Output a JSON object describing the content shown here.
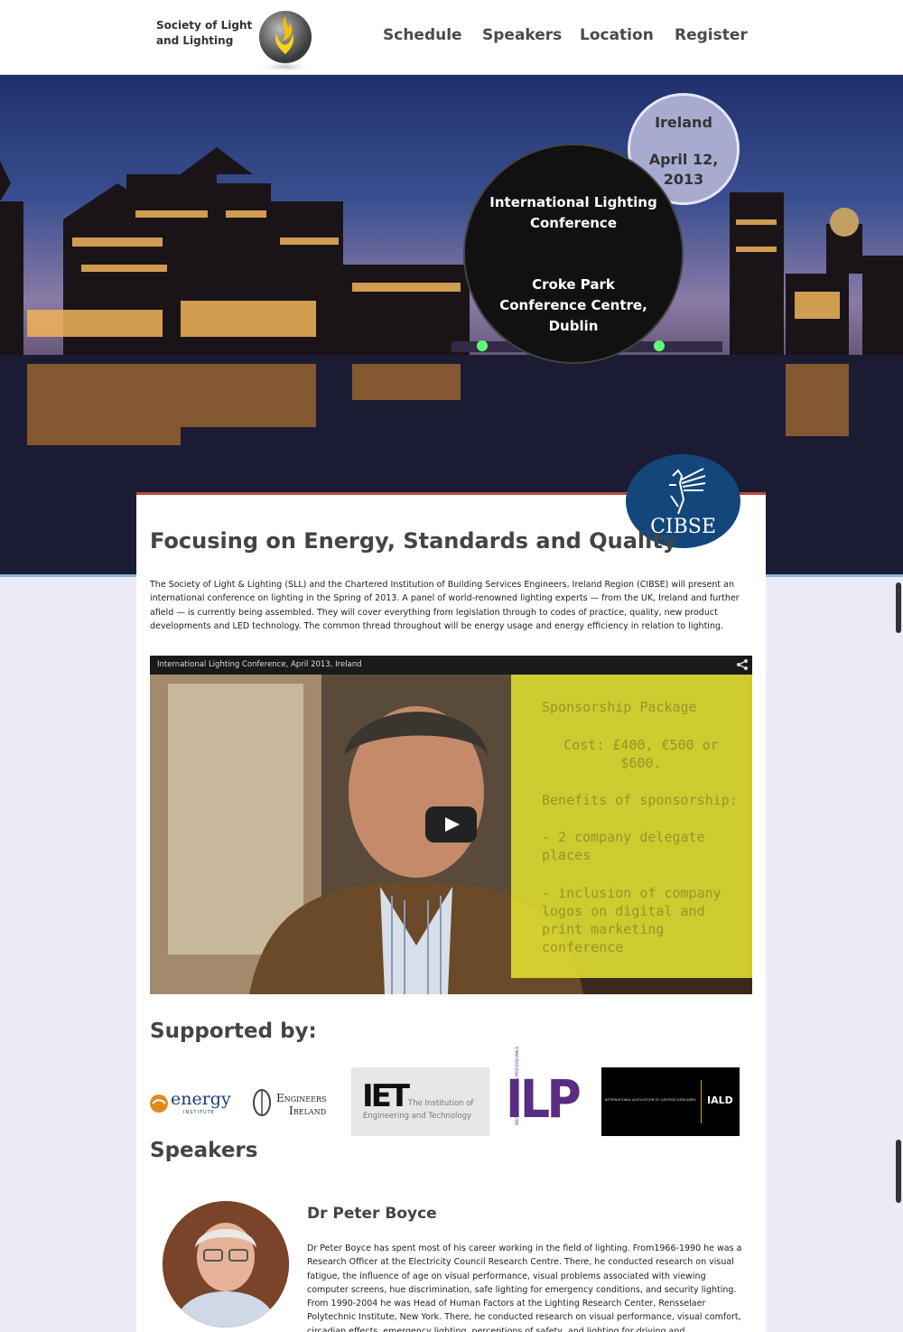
{
  "header": {
    "brand_line1": "Society of Light",
    "brand_line2": "and Lighting",
    "nav": [
      "Schedule",
      "Speakers",
      "Location",
      "Register"
    ]
  },
  "hero": {
    "country": "Ireland",
    "date": "April 12, 2013",
    "conference_title": "International Lighting Conference",
    "venue": "Croke Park Conference Centre, Dublin",
    "badge": "CIBSE"
  },
  "main": {
    "heading": "Focusing on Energy, Standards and Quality",
    "intro": "The Society of Light & Lighting (SLL) and the Chartered Institution of Building Services Engineers, Ireland Region (CIBSE) will present an international conference on lighting in the Spring of 2013. A panel of world-renowned lighting experts — from the UK, Ireland and further afield — is currently being assembled. They will cover everything from legislation through to codes of practice, quality, new product developments and LED technology. The common thread throughout will be energy usage and energy efficiency in relation to lighting."
  },
  "video": {
    "title": "International Lighting Conference, April 2013, Ireland",
    "sponsor_heading": "Sponsorship Package",
    "sponsor_cost": "Cost: £400, €500 or $600.",
    "sponsor_benefits": "Benefits of sponsorship:",
    "sponsor_item1": "- 2 company delegate places",
    "sponsor_item2": "- inclusion of company logos on digital and print marketing conference"
  },
  "supported": {
    "heading": "Supported by:",
    "logos": {
      "energy": "energy",
      "energy_sub": "INSTITUTE",
      "engineers1": "Engineers",
      "engineers2": "Ireland",
      "iet": "IET",
      "iet_sub1": "The Institution of",
      "iet_sub2": "Engineering and Technology",
      "ilp": "ILP",
      "ilp_vertical": "INSTITUTION OF LIGHTING PROFESSIONALS",
      "iald": "IALD",
      "iald_full": "INTERNATIONAL ASSOCIATION OF LIGHTING DESIGNERS"
    }
  },
  "speakers": {
    "heading": "Speakers",
    "items": [
      {
        "name": "Dr Peter Boyce",
        "bio": "Dr Peter Boyce has spent most of his career working in the field of lighting. From1966-1990 he was a Research Officer at the Electricity Council Research Centre. There, he conducted research on visual fatigue, the influence of age on visual performance, visual problems associated with viewing computer screens, hue discrimination, safe lighting for emergency conditions, and security lighting. From 1990-2004 he was Head of Human Factors at the Lighting Research Center, Rensselaer Polytechnic Institute, New York. There, he conducted research on visual performance, visual comfort, circadian effects, emergency lighting, perceptions of safety, and lighting for driving and"
      }
    ]
  },
  "colors": {
    "panel_top_border": "#b94a3a",
    "cibse_blue": "#13477c",
    "sponsor_yellow": "#e1e132",
    "page_bg": "#ebebf8"
  }
}
